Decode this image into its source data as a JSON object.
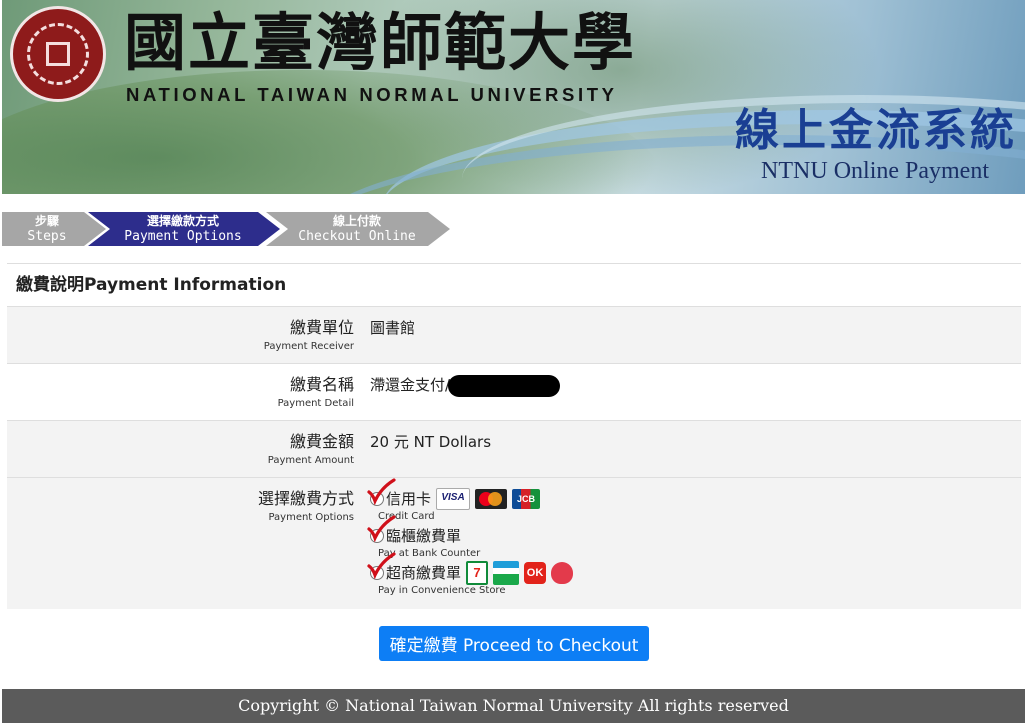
{
  "header": {
    "university_zh": "國立臺灣師範大學",
    "university_en": "NATIONAL TAIWAN NORMAL UNIVERSITY",
    "system_zh": "線上金流系統",
    "system_en": "NTNU Online Payment",
    "seal_icon": "ntnu-seal-icon",
    "seal_color": "#8e1b1b"
  },
  "steps": [
    {
      "zh": "步驟",
      "en": "Steps",
      "active": false
    },
    {
      "zh": "選擇繳款方式",
      "en": "Payment Options",
      "active": true
    },
    {
      "zh": "線上付款",
      "en": "Checkout Online",
      "active": false
    }
  ],
  "info": {
    "title": "繳費說明Payment Information",
    "rows": [
      {
        "label_zh": "繳費單位",
        "label_en": "Payment Receiver",
        "value": "圖書館"
      },
      {
        "label_zh": "繳費名稱",
        "label_en": "Payment Detail",
        "value": "滯還金支付/"
      },
      {
        "label_zh": "繳費金額",
        "label_en": "Payment Amount",
        "value": "20 元 NT Dollars"
      }
    ],
    "options_label_zh": "選擇繳費方式",
    "options_label_en": "Payment Options",
    "options": [
      {
        "zh": "信用卡",
        "en": "Credit Card",
        "logos": [
          "VISA",
          "MasterCard",
          "JCB"
        ]
      },
      {
        "zh": "臨櫃繳費單",
        "en": "Pay at Bank Counter",
        "logos": []
      },
      {
        "zh": "超商繳費單",
        "en": "Pay in Convenience Store",
        "logos": [
          "7",
          "FamilyMart",
          "OK",
          "Hi-Life"
        ]
      }
    ]
  },
  "checkout_button": "確定繳費 Proceed to Checkout",
  "footer": "Copyright © National Taiwan Normal University All rights reserved",
  "colors": {
    "active_step": "#2d2d8c",
    "inactive_step": "#a6a6a6",
    "button": "#0d7ef5",
    "footer": "#5b5b5b",
    "check_mark": "#d0101a",
    "system_title": "#1a3f93"
  }
}
